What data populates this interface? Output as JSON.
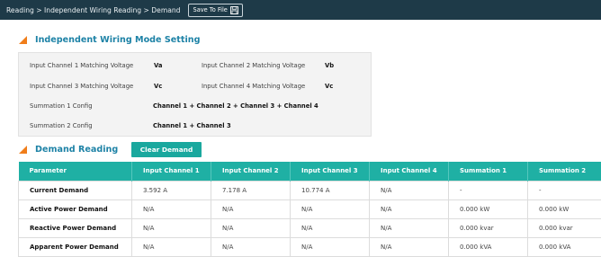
{
  "header": {
    "breadcrumb": "Reading > Independent Wiring Reading > Demand",
    "save_label": "Save To File"
  },
  "wiring": {
    "title": "Independent Wiring Mode Setting",
    "ch1_label": "Input Channel 1 Matching Voltage",
    "ch1_value": "Va",
    "ch2_label": "Input Channel 2 Matching Voltage",
    "ch2_value": "Vb",
    "ch3_label": "Input Channel 3 Matching Voltage",
    "ch3_value": "Vc",
    "ch4_label": "Input Channel 4 Matching Voltage",
    "ch4_value": "Vc",
    "sum1_label": "Summation 1 Config",
    "sum1_value": "Channel 1 + Channel 2 + Channel 3 + Channel 4",
    "sum2_label": "Summation 2 Config",
    "sum2_value": "Channel 1 + Channel 3"
  },
  "demand": {
    "title": "Demand Reading",
    "clear_label": "Clear Demand",
    "columns": [
      "Parameter",
      "Input Channel 1",
      "Input Channel 2",
      "Input Channel 3",
      "Input Channel 4",
      "Summation 1",
      "Summation 2"
    ],
    "rows": [
      [
        "Current Demand",
        "3.592 A",
        "7.178 A",
        "10.774 A",
        "N/A",
        "-",
        "-"
      ],
      [
        "Active Power Demand",
        "N/A",
        "N/A",
        "N/A",
        "N/A",
        "0.000 kW",
        "0.000 kW"
      ],
      [
        "Reactive Power Demand",
        "N/A",
        "N/A",
        "N/A",
        "N/A",
        "0.000 kvar",
        "0.000 kvar"
      ],
      [
        "Apparent Power Demand",
        "N/A",
        "N/A",
        "N/A",
        "N/A",
        "0.000 kVA",
        "0.000 kVA"
      ]
    ]
  },
  "colors": {
    "header_bg": "#1e3a48",
    "accent_title": "#1d82a6",
    "triangle": "#f07d1a",
    "table_header": "#1fb0a4",
    "button": "#1aa89e"
  },
  "icons": {
    "save": "floppy-disk-icon",
    "section_marker": "triangle-marker-icon"
  }
}
